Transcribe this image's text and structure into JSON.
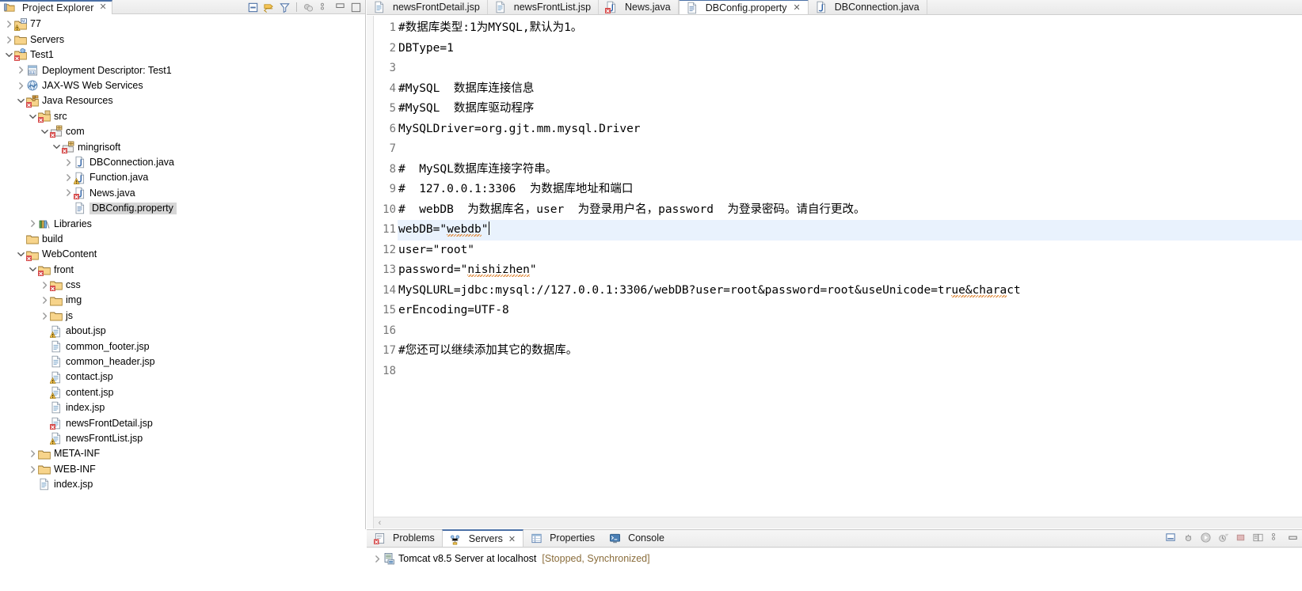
{
  "explorer": {
    "title": "Project Explorer",
    "close_label": "✕",
    "toolbar": [
      {
        "name": "collapse-all-icon",
        "tip": "Collapse All"
      },
      {
        "name": "link-with-editor-icon",
        "tip": "Link with Editor"
      },
      {
        "name": "filter-icon",
        "tip": "Filters"
      },
      {
        "name": "view-menu-icon",
        "tip": "View Menu"
      },
      {
        "name": "minimize-icon",
        "tip": "Minimize"
      },
      {
        "name": "maximize-icon",
        "tip": "Maximize"
      }
    ],
    "tree": [
      {
        "label": "77",
        "depth": 0,
        "twisty": "collapsed",
        "icon": "java-project-icon"
      },
      {
        "label": "Servers",
        "depth": 0,
        "twisty": "collapsed",
        "icon": "folder-icon"
      },
      {
        "label": "Test1",
        "depth": 0,
        "twisty": "expanded",
        "icon": "web-project-error-icon"
      },
      {
        "label": "Deployment Descriptor: Test1",
        "depth": 1,
        "twisty": "collapsed",
        "icon": "deployment-descriptor-icon"
      },
      {
        "label": "JAX-WS Web Services",
        "depth": 1,
        "twisty": "collapsed",
        "icon": "web-service-icon"
      },
      {
        "label": "Java Resources",
        "depth": 1,
        "twisty": "expanded",
        "icon": "java-resources-error-icon"
      },
      {
        "label": "src",
        "depth": 2,
        "twisty": "expanded",
        "icon": "source-folder-error-icon"
      },
      {
        "label": "com",
        "depth": 3,
        "twisty": "expanded",
        "icon": "package-error-icon"
      },
      {
        "label": "mingrisoft",
        "depth": 4,
        "twisty": "expanded",
        "icon": "package-error-icon"
      },
      {
        "label": "DBConnection.java",
        "depth": 5,
        "twisty": "collapsed",
        "icon": "java-file-icon"
      },
      {
        "label": "Function.java",
        "depth": 5,
        "twisty": "collapsed",
        "icon": "java-file-warning-icon"
      },
      {
        "label": "News.java",
        "depth": 5,
        "twisty": "collapsed",
        "icon": "java-file-error-icon"
      },
      {
        "label": "DBConfig.property",
        "depth": 5,
        "twisty": "none",
        "icon": "property-file-icon",
        "selected": true
      },
      {
        "label": "Libraries",
        "depth": 2,
        "twisty": "collapsed",
        "icon": "libraries-icon"
      },
      {
        "label": "build",
        "depth": 1,
        "twisty": "none",
        "icon": "folder-icon"
      },
      {
        "label": "WebContent",
        "depth": 1,
        "twisty": "expanded",
        "icon": "folder-error-icon"
      },
      {
        "label": "front",
        "depth": 2,
        "twisty": "expanded",
        "icon": "folder-error-icon"
      },
      {
        "label": "css",
        "depth": 3,
        "twisty": "collapsed",
        "icon": "folder-error-icon"
      },
      {
        "label": "img",
        "depth": 3,
        "twisty": "collapsed",
        "icon": "folder-icon"
      },
      {
        "label": "js",
        "depth": 3,
        "twisty": "collapsed",
        "icon": "folder-icon"
      },
      {
        "label": "about.jsp",
        "depth": 3,
        "twisty": "none",
        "icon": "jsp-file-warning-icon"
      },
      {
        "label": "common_footer.jsp",
        "depth": 3,
        "twisty": "none",
        "icon": "jsp-file-icon"
      },
      {
        "label": "common_header.jsp",
        "depth": 3,
        "twisty": "none",
        "icon": "jsp-file-icon"
      },
      {
        "label": "contact.jsp",
        "depth": 3,
        "twisty": "none",
        "icon": "jsp-file-warning-icon"
      },
      {
        "label": "content.jsp",
        "depth": 3,
        "twisty": "none",
        "icon": "jsp-file-warning-icon"
      },
      {
        "label": "index.jsp",
        "depth": 3,
        "twisty": "none",
        "icon": "jsp-file-icon"
      },
      {
        "label": "newsFrontDetail.jsp",
        "depth": 3,
        "twisty": "none",
        "icon": "jsp-file-error-icon"
      },
      {
        "label": "newsFrontList.jsp",
        "depth": 3,
        "twisty": "none",
        "icon": "jsp-file-warning-icon"
      },
      {
        "label": "META-INF",
        "depth": 2,
        "twisty": "collapsed",
        "icon": "folder-icon"
      },
      {
        "label": "WEB-INF",
        "depth": 2,
        "twisty": "collapsed",
        "icon": "folder-icon"
      },
      {
        "label": "index.jsp",
        "depth": 2,
        "twisty": "none",
        "icon": "jsp-file-icon"
      }
    ]
  },
  "editor": {
    "tabs": [
      {
        "label": "newsFrontDetail.jsp",
        "icon": "jsp-file-icon",
        "active": false,
        "closable": false
      },
      {
        "label": "newsFrontList.jsp",
        "icon": "jsp-file-icon",
        "active": false,
        "closable": false
      },
      {
        "label": "News.java",
        "icon": "java-file-error-icon",
        "active": false,
        "closable": false
      },
      {
        "label": "DBConfig.property",
        "icon": "property-file-icon",
        "active": true,
        "closable": true,
        "close_label": "✕"
      },
      {
        "label": "DBConnection.java",
        "icon": "java-file-icon",
        "active": false,
        "closable": false
      }
    ],
    "lines": [
      {
        "n": "1",
        "text": "#数据库类型:1为MYSQL,默认为1。"
      },
      {
        "n": "2",
        "text": "DBType=1"
      },
      {
        "n": "3",
        "text": ""
      },
      {
        "n": "4",
        "text": "#MySQL  数据库连接信息"
      },
      {
        "n": "5",
        "text": "#MySQL  数据库驱动程序"
      },
      {
        "n": "6",
        "text": "MySQLDriver=org.gjt.mm.mysql.Driver"
      },
      {
        "n": "7",
        "text": ""
      },
      {
        "n": "8",
        "text": "#  MySQL数据库连接字符串。"
      },
      {
        "n": "9",
        "text": "#  127.0.0.1:3306  为数据库地址和端口"
      },
      {
        "n": "10",
        "text": "#  webDB  为数据库名，user  为登录用户名，password  为登录密码。请自行更改。"
      },
      {
        "n": "11",
        "text": "webDB=\"webdb\"",
        "current": true,
        "caret": true,
        "squiggle_from": 7,
        "squiggle_to": 12
      },
      {
        "n": "12",
        "text": "user=\"root\""
      },
      {
        "n": "13",
        "text": "password=\"nishizhen\"",
        "squiggle_from": 10,
        "squiggle_to": 19
      },
      {
        "n": "14",
        "text": "MySQLURL=jdbc:mysql://127.0.0.1:3306/webDB?user=root&password=root&useUnicode=true&charact",
        "squiggle_from": 80,
        "squiggle_to": 88
      },
      {
        "n": "15",
        "text": "erEncoding=UTF-8"
      },
      {
        "n": "16",
        "text": ""
      },
      {
        "n": "17",
        "text": "#您还可以继续添加其它的数据库。"
      },
      {
        "n": "18",
        "text": ""
      }
    ],
    "hscroll_arrow": "‹"
  },
  "bottom": {
    "tabs": [
      {
        "label": "Problems",
        "icon": "problems-icon",
        "active": false,
        "closable": false
      },
      {
        "label": "Servers",
        "icon": "servers-icon",
        "active": true,
        "closable": true,
        "close_label": "✕"
      },
      {
        "label": "Properties",
        "icon": "properties-icon",
        "active": false,
        "closable": false
      },
      {
        "label": "Console",
        "icon": "console-icon",
        "active": false,
        "closable": false
      }
    ],
    "toolbar": [
      {
        "name": "new-server-icon"
      },
      {
        "name": "debug-icon"
      },
      {
        "name": "start-icon"
      },
      {
        "name": "profile-icon"
      },
      {
        "name": "stop-icon"
      },
      {
        "name": "publish-icon"
      },
      {
        "name": "view-menu-icon"
      },
      {
        "name": "minimize-icon"
      }
    ],
    "servers": [
      {
        "name": "Tomcat v8.5 Server at localhost",
        "state": "[Stopped, Synchronized]",
        "icon": "server-icon",
        "twisty": "collapsed"
      }
    ]
  },
  "colors": {
    "tab_accent": "#4a6fa5",
    "current_line": "#e9f2fd",
    "selection_grey": "#d6d6d6",
    "squiggle": "#e08a3c",
    "server_state": "#8a6d3b",
    "gutter_text": "#777777"
  }
}
